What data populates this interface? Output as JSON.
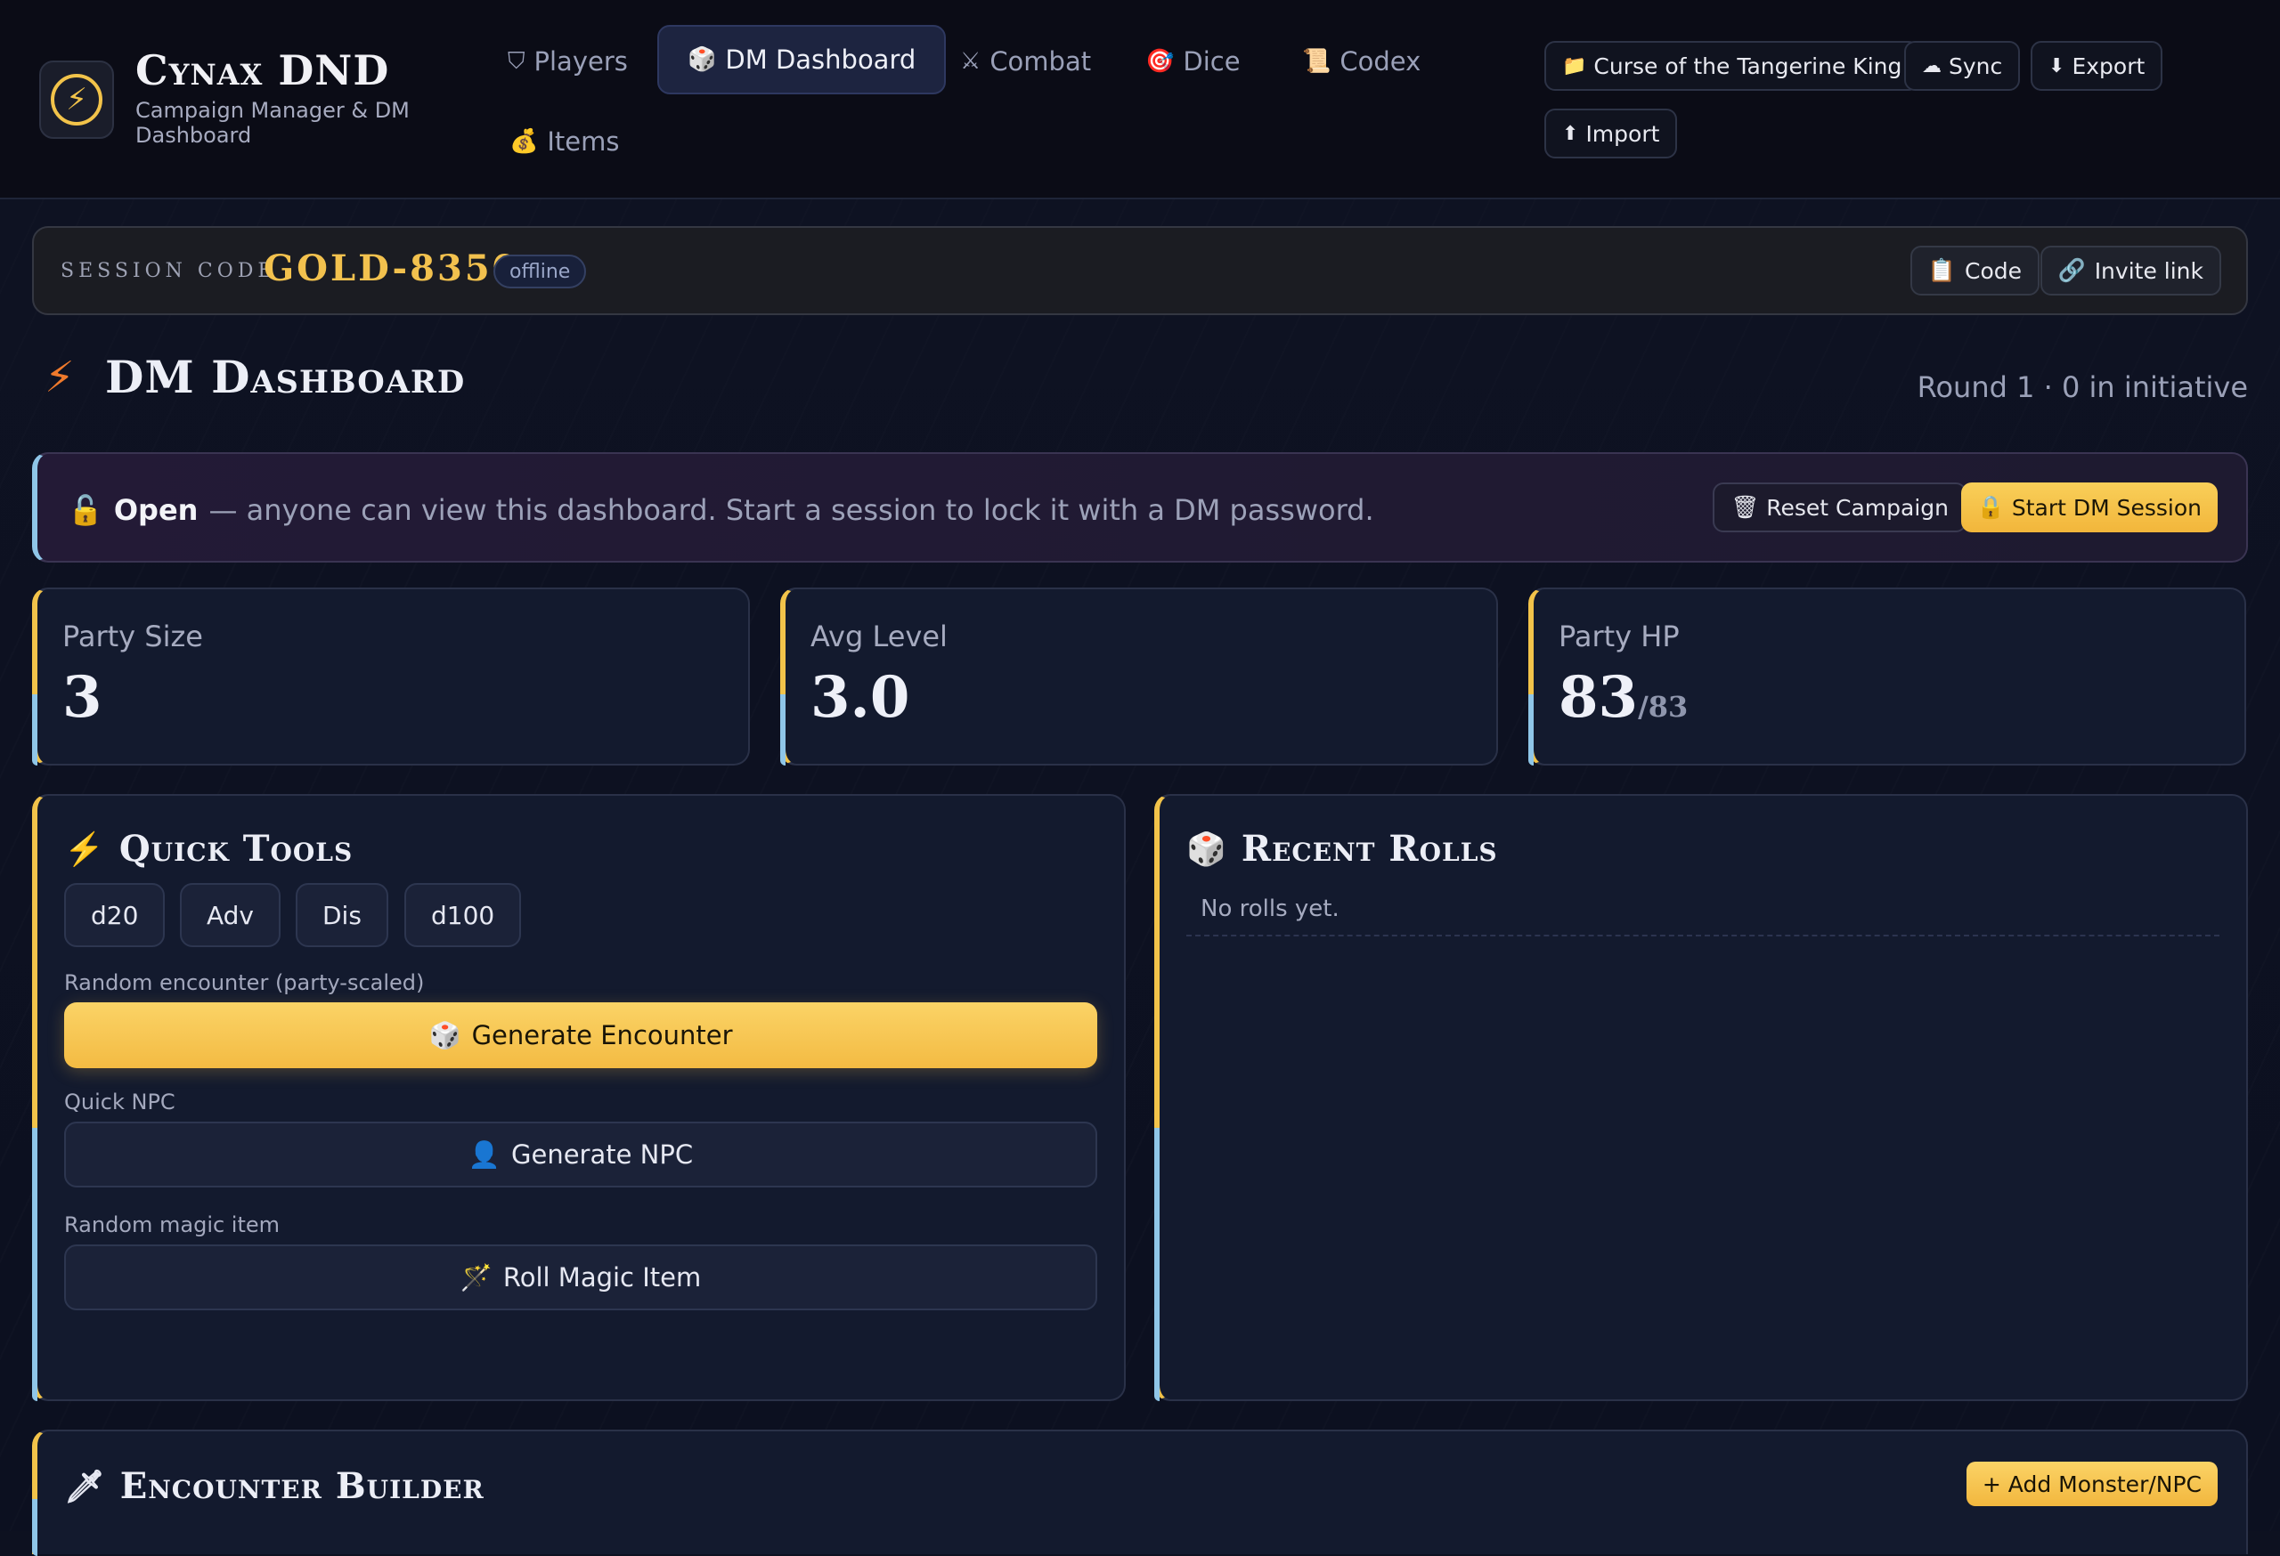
{
  "brand": {
    "title": "Cynax DND",
    "subtitle": "Campaign Manager & DM Dashboard"
  },
  "nav": [
    {
      "label": "Players",
      "icon": "shield-icon",
      "glyph": "⛉",
      "active": false
    },
    {
      "label": "DM Dashboard",
      "icon": "dice-icon",
      "glyph": "🎲",
      "active": true
    },
    {
      "label": "Combat",
      "icon": "crossed-swords-icon",
      "glyph": "⚔",
      "active": false
    },
    {
      "label": "Dice",
      "icon": "target-icon",
      "glyph": "🎯",
      "active": false
    },
    {
      "label": "Codex",
      "icon": "scroll-icon",
      "glyph": "📜",
      "active": false
    },
    {
      "label": "Items",
      "icon": "money-bag-icon",
      "glyph": "💰",
      "active": false
    }
  ],
  "header_actions": {
    "campaign": "Curse of the Tangerine King",
    "sync": "Sync",
    "export": "Export",
    "import": "Import"
  },
  "session": {
    "label": "SESSION CODE",
    "code": "GOLD-8350",
    "status": "offline",
    "code_button": "Code",
    "invite_button": "Invite link"
  },
  "page": {
    "title": "DM Dashboard",
    "round_info": "Round 1 · 0 in initiative"
  },
  "access": {
    "status": "Open",
    "message": "— anyone can view this dashboard. Start a session to lock it with a DM password.",
    "reset_button": "Reset Campaign",
    "start_button": "Start DM Session"
  },
  "stats": {
    "party_size": {
      "label": "Party Size",
      "value": "3"
    },
    "avg_level": {
      "label": "Avg Level",
      "value": "3.0"
    },
    "party_hp": {
      "label": "Party HP",
      "value": "83",
      "max": "/83"
    }
  },
  "quick_tools": {
    "title": "Quick Tools",
    "dice": [
      "d20",
      "Adv",
      "Dis",
      "d100"
    ],
    "encounter_label": "Random encounter (party-scaled)",
    "encounter_button": "Generate Encounter",
    "npc_label": "Quick NPC",
    "npc_button": "Generate NPC",
    "magic_label": "Random magic item",
    "magic_button": "Roll Magic Item"
  },
  "recent_rolls": {
    "title": "Recent Rolls",
    "empty": "No rolls yet."
  },
  "encounter_builder": {
    "title": "Encounter Builder",
    "add_button": "+ Add Monster/NPC"
  },
  "colors": {
    "accent_gold": "#f2c34a",
    "accent_blue": "#8fc6e8",
    "bg": "#0d1120",
    "panel": "#131a2e"
  }
}
